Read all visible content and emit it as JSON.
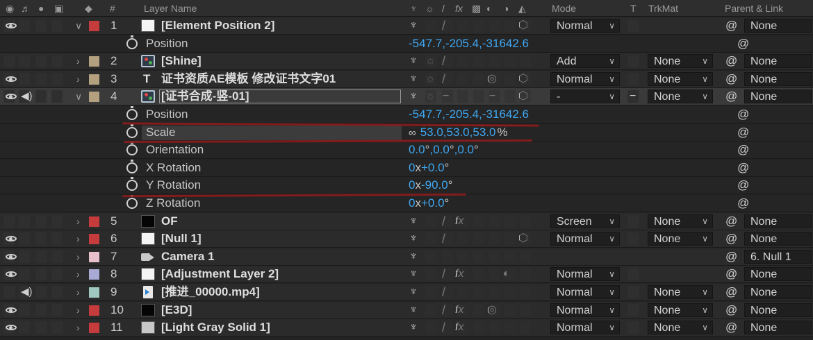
{
  "header": {
    "hash": "#",
    "layer_name": "Layer Name",
    "mode": "Mode",
    "t": "T",
    "trkmat": "TrkMat",
    "parent_link": "Parent & Link"
  },
  "layers": [
    {
      "num": "1",
      "name": "[Element Position 2]",
      "label_color": "#c63b3b",
      "source": "solid-white",
      "mode": "Normal",
      "trkmat": "",
      "parent": "None",
      "eye": true,
      "audio": false,
      "expanded": true,
      "switch_fx": false,
      "switch_3d": true
    },
    {
      "num": "2",
      "name": "[Shine]",
      "label_color": "#b3a07f",
      "source": "comp",
      "mode": "Add",
      "trkmat": "None",
      "parent": "None",
      "eye": false,
      "audio": false,
      "expanded": false
    },
    {
      "num": "3",
      "name": "证书资质AE模板 修改证书文字01",
      "label_color": "#b3a07f",
      "source": "text",
      "mode": "Normal",
      "trkmat": "None",
      "parent": "None",
      "eye": true,
      "audio": false,
      "expanded": false
    },
    {
      "num": "4",
      "name": "[证书合成-竖-01]",
      "label_color": "#b3a07f",
      "source": "comp",
      "mode": "-",
      "trkmat": "None",
      "parent": "None",
      "eye": true,
      "audio": true,
      "expanded": true
    },
    {
      "num": "5",
      "name": "OF",
      "label_color": "#c63b3b",
      "source": "solid-black",
      "mode": "Screen",
      "trkmat": "None",
      "parent": "None",
      "eye": false,
      "audio": false,
      "expanded": false
    },
    {
      "num": "6",
      "name": "[Null 1]",
      "label_color": "#c63b3b",
      "source": "solid-white",
      "mode": "Normal",
      "trkmat": "None",
      "parent": "None",
      "eye": true,
      "audio": false,
      "expanded": false
    },
    {
      "num": "7",
      "name": "Camera 1",
      "label_color": "#e8c0cc",
      "source": "camera",
      "mode": "",
      "trkmat": "",
      "parent": "6. Null 1",
      "eye": true,
      "audio": false,
      "expanded": false
    },
    {
      "num": "8",
      "name": "[Adjustment Layer 2]",
      "label_color": "#a9a9d6",
      "source": "solid-white",
      "mode": "Normal",
      "trkmat": "",
      "parent": "None",
      "eye": true,
      "audio": false,
      "expanded": false
    },
    {
      "num": "9",
      "name": "[推进_00000.mp4]",
      "label_color": "#9fc9c0",
      "source": "footage",
      "mode": "Normal",
      "trkmat": "None",
      "parent": "None",
      "eye": false,
      "audio": true,
      "expanded": false
    },
    {
      "num": "10",
      "name": "[E3D]",
      "label_color": "#c63b3b",
      "source": "solid-black",
      "mode": "Normal",
      "trkmat": "None",
      "parent": "None",
      "eye": true,
      "audio": false,
      "expanded": false
    },
    {
      "num": "11",
      "name": "[Light Gray Solid 1]",
      "label_color": "#c63b3b",
      "source": "solid-gray",
      "mode": "Normal",
      "trkmat": "None",
      "parent": "None",
      "eye": true,
      "audio": false,
      "expanded": false
    }
  ],
  "layer1_props": {
    "position": {
      "name": "Position",
      "x": "-547.7",
      "y": "-205.4",
      "z": "-31642.6"
    }
  },
  "layer4_props": {
    "position": {
      "name": "Position",
      "x": "-547.7",
      "y": "-205.4",
      "z": "-31642.6"
    },
    "scale": {
      "name": "Scale",
      "x": "53.0",
      "y": "53.0",
      "z": "53.0",
      "unit": "%"
    },
    "orientation": {
      "name": "Orientation",
      "x": "0.0",
      "y": "0.0",
      "z": "0.0",
      "unit": "°"
    },
    "x_rotation": {
      "name": "X Rotation",
      "rev": "0",
      "x": "x",
      "deg": "+0.0",
      "unit": "°"
    },
    "y_rotation": {
      "name": "Y Rotation",
      "rev": "0",
      "x": "x",
      "deg": "-90.0",
      "unit": "°"
    },
    "z_rotation": {
      "name": "Z Rotation",
      "rev": "0",
      "x": "x",
      "deg": "+0.0",
      "unit": "°"
    }
  },
  "glyphs": {
    "comma": ",",
    "fx": "fx",
    "slash": "/",
    "minus": "−",
    "chevron_right": "›",
    "chevron_down": "∨",
    "dropdown_arrow": "∨",
    "spiral": "@",
    "text_t": "T"
  },
  "colors": {
    "value_blue": "#3fa7f0",
    "annotation_red": "#8e1c1c",
    "panel_bg": "#232323"
  }
}
